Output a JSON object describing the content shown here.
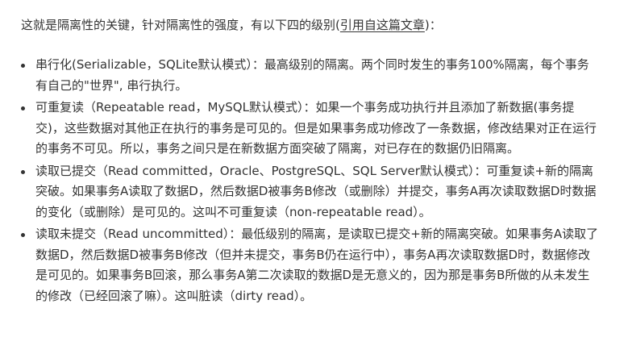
{
  "intro": {
    "text_before": "这就是隔离性的关键，针对隔离性的强度，有以下四的级别(",
    "link_text": "引用自这篇文章",
    "text_after": ")："
  },
  "levels": [
    {
      "text": "串行化(Serializable，SQLite默认模式）：最高级别的隔离。两个同时发生的事务100%隔离，每个事务有自己的\"世界\", 串行执行。"
    },
    {
      "text": "可重复读（Repeatable read，MySQL默认模式）：如果一个事务成功执行并且添加了新数据(事务提交)，这些数据对其他正在执行的事务是可见的。但是如果事务成功修改了一条数据，修改结果对正在运行的事务不可见。所以，事务之间只是在新数据方面突破了隔离，对已存在的数据仍旧隔离。"
    },
    {
      "text": "读取已提交（Read committed，Oracle、PostgreSQL、SQL Server默认模式）：可重复读+新的隔离突破。如果事务A读取了数据D，然后数据D被事务B修改（或删除）并提交，事务A再次读取数据D时数据的变化（或删除）是可见的。这叫不可重复读（non-repeatable read）。"
    },
    {
      "text": "读取未提交（Read uncommitted）：最低级别的隔离，是读取已提交+新的隔离突破。如果事务A读取了数据D，然后数据D被事务B修改（但并未提交，事务B仍在运行中），事务A再次读取数据D时，数据修改是可见的。如果事务B回滚，那么事务A第二次读取的数据D是无意义的，因为那是事务B所做的从未发生的修改（已经回滚了嘛）。这叫脏读（dirty read）。"
    }
  ]
}
